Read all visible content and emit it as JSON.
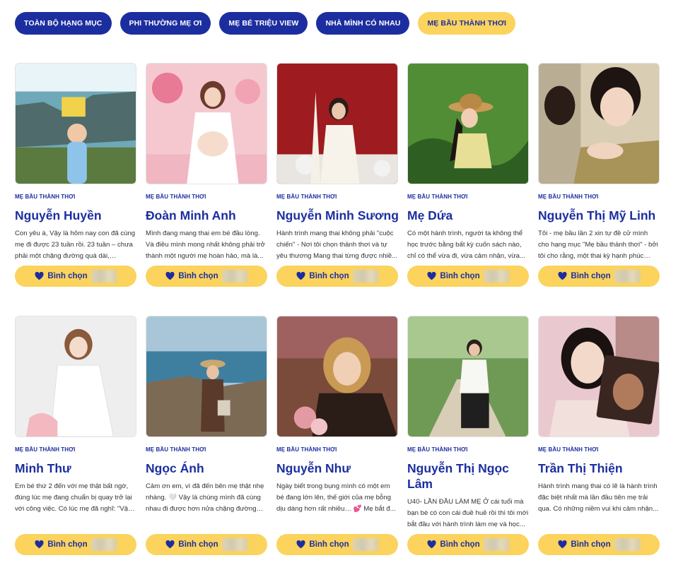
{
  "tabs": [
    {
      "label": "TOÀN BỘ HẠNG MỤC",
      "active": false
    },
    {
      "label": "PHI THƯỜNG MẸ ƠI",
      "active": false
    },
    {
      "label": "MẸ BÉ TRIỆU VIEW",
      "active": false
    },
    {
      "label": "NHÀ MÌNH CÓ NHAU",
      "active": false
    },
    {
      "label": "MẸ BẦU THÀNH THƠI",
      "active": true
    }
  ],
  "colors": {
    "brand_blue": "#1c2e9f",
    "accent_yellow": "#fbd35d"
  },
  "vote_label": "Bình chọn",
  "cards": [
    {
      "category": "MẸ BẦU THÀNH THƠI",
      "name": "Nguyễn Huyền",
      "desc": "Con yêu à, Vậy là hôm nay con đã cùng mẹ đi được 23 tuần rồi. 23 tuần – chưa phải một chặng đường quá dài, nhưng..."
    },
    {
      "category": "MẸ BẦU THÀNH THƠI",
      "name": "Đoàn Minh Anh",
      "desc": "Mình đang mang thai em bé đầu lòng. Và điều mình mong nhất không phải trở thành một người mẹ hoàn hảo, mà là..."
    },
    {
      "category": "MẸ BẦU THÀNH THƠI",
      "name": "Nguyễn Minh Sương",
      "desc": "Hành trình mang thai không phải \"cuộc chiến\" - Nơi tôi chọn thảnh thơi và tự yêu thương Mang thai từng được nhiề..."
    },
    {
      "category": "MẸ BẦU THÀNH THƠI",
      "name": "Mẹ Dứa",
      "desc": "Có một hành trình, người ta không thể học trước bằng bất kỳ cuốn sách nào, chỉ có thể vừa đi, vừa cảm nhận, vừa..."
    },
    {
      "category": "MẸ BẦU THÀNH THƠI",
      "name": "Nguyễn Thị Mỹ Linh",
      "desc": "Tôi - mẹ bầu lần 2 xin tự đề cử mình cho hạng mục \"Mẹ bầu thảnh thơi\" - bởi tôi cho rằng, một thai kỳ hạnh phúc khôn..."
    },
    {
      "category": "MẸ BẦU THÀNH THƠI",
      "name": "Minh Thư",
      "desc": "Em bé thứ 2 đến với mẹ thật bất ngờ, đúng lúc mẹ đang chuẩn bị quay trở lại với công việc. Có lúc mẹ đã nghĩ: \"Vậy ..."
    },
    {
      "category": "MẸ BẦU THÀNH THƠI",
      "name": "Ngọc Ánh",
      "desc": "Cảm ơn em, vì đã đến bên mẹ thật nhẹ nhàng. 🤍 Vậy là chúng mình đã cùng nhau đi được hơn nửa chặng đường rồ..."
    },
    {
      "category": "MẸ BẦU THÀNH THƠI",
      "name": "Nguyễn Như",
      "desc": "Ngày biết trong bụng mình có một em bé đang lớn lên, thế giới của mẹ bỗng dịu dàng hơn rất nhiều… 💕 Mẹ bắt đ..."
    },
    {
      "category": "MẸ BẦU THÀNH THƠI",
      "name": "Nguyễn Thị Ngọc Lâm",
      "desc": "U40- LẦN ĐẦU LÀM MẸ Ở cái tuổi mà bạn bè có con cái đuề huề rồi thì tôi mới bắt đầu với hành trình làm mẹ và học..."
    },
    {
      "category": "MẸ BẦU THÀNH THƠI",
      "name": "Trần Thị Thiện",
      "desc": "Hành trình mang thai có lẽ là hành trình đặc biệt nhất mà lần đầu tiên mẹ trải qua. Có những niềm vui khi cảm nhận..."
    }
  ]
}
